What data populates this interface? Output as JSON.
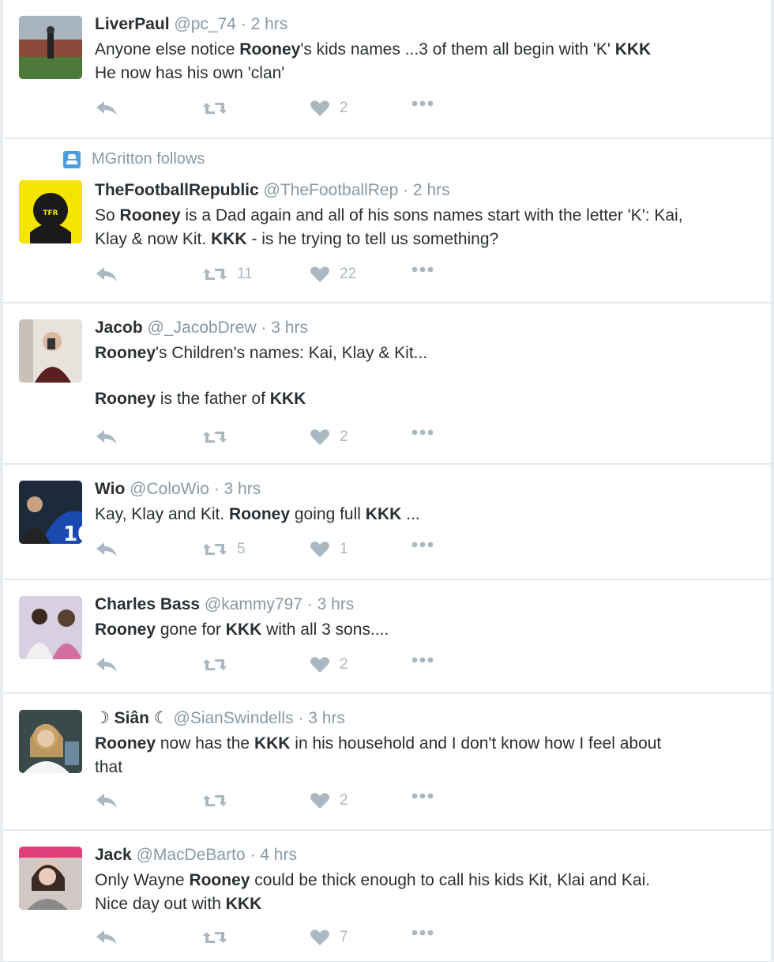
{
  "tweets": [
    {
      "name": "LiverPaul",
      "handle": "@pc_74",
      "time": "· 2 hrs",
      "segments": [
        {
          "t": "Anyone else notice "
        },
        {
          "t": "Rooney",
          "b": true
        },
        {
          "t": "'s kids names ...3 of them all begin with 'K' "
        },
        {
          "t": "KKK",
          "b": true
        },
        {
          "br": true
        },
        {
          "t": "He now has his own 'clan'"
        }
      ],
      "retweets": "",
      "likes": "2"
    },
    {
      "context": "MGritton follows",
      "name": "TheFootballRepublic",
      "handle": "@TheFootballRep",
      "time": "· 2 hrs",
      "segments": [
        {
          "t": "So "
        },
        {
          "t": "Rooney",
          "b": true
        },
        {
          "t": " is a Dad again and all of his sons names start with the letter 'K': Kai,"
        },
        {
          "br": true
        },
        {
          "t": "Klay & now Kit. "
        },
        {
          "t": "KKK",
          "b": true
        },
        {
          "t": " - is he trying to tell us something?"
        }
      ],
      "retweets": "11",
      "likes": "22"
    },
    {
      "name": "Jacob",
      "handle": "@_JacobDrew",
      "time": "· 3 hrs",
      "segments": [
        {
          "t": "Rooney",
          "b": true
        },
        {
          "t": "'s Children's names: Kai, Klay & Kit..."
        },
        {
          "gap": true
        },
        {
          "t": "Rooney",
          "b": true
        },
        {
          "t": " is the father of "
        },
        {
          "t": "KKK",
          "b": true
        }
      ],
      "retweets": "",
      "likes": "2"
    },
    {
      "name": "Wio",
      "handle": "@ColoWio",
      "time": "· 3 hrs",
      "segments": [
        {
          "t": "Kay, Klay and Kit.  "
        },
        {
          "t": "Rooney",
          "b": true
        },
        {
          "t": " going full "
        },
        {
          "t": "KKK",
          "b": true
        },
        {
          "t": " ..."
        }
      ],
      "retweets": "5",
      "likes": "1"
    },
    {
      "name": "Charles Bass",
      "handle": "@kammy797",
      "time": "· 3 hrs",
      "segments": [
        {
          "t": "Rooney",
          "b": true
        },
        {
          "t": " gone for "
        },
        {
          "t": "KKK",
          "b": true
        },
        {
          "t": " with all 3 sons...."
        }
      ],
      "retweets": "",
      "likes": "2"
    },
    {
      "name": "☽ Siân ☾",
      "handle": "@SianSwindells",
      "time": "· 3 hrs",
      "segments": [
        {
          "t": "Rooney",
          "b": true
        },
        {
          "t": " now has the "
        },
        {
          "t": "KKK",
          "b": true
        },
        {
          "t": " in his household and I don't know how I feel about"
        },
        {
          "br": true
        },
        {
          "t": "that"
        }
      ],
      "retweets": "",
      "likes": "2"
    },
    {
      "name": "Jack",
      "handle": "@MacDeBarto",
      "time": "· 4 hrs",
      "segments": [
        {
          "t": "Only Wayne "
        },
        {
          "t": "Rooney",
          "b": true
        },
        {
          "t": " could be thick enough to call his kids Kit, Klai and Kai."
        },
        {
          "br": true
        },
        {
          "t": "Nice day out with "
        },
        {
          "t": "KKK",
          "b": true
        }
      ],
      "retweets": "",
      "likes": "7"
    }
  ],
  "colors": {
    "action_gray": "#aab8c2",
    "meta_gray": "#8899a6",
    "text": "#292f33",
    "context_icon": "#4a9fe0"
  }
}
